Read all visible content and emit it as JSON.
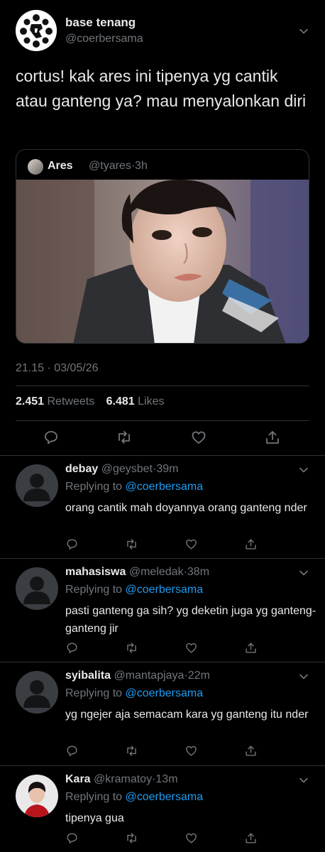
{
  "tweet": {
    "author_name": "base tenang",
    "author_handle": "@coerbersama",
    "text": "cortus! kak ares ini tipenya yg cantik atau ganteng ya? mau menyalonkan diri",
    "quote": {
      "name": "Ares",
      "handle": "@tyares",
      "time": "3h"
    },
    "timestamp": "21.15 · 03/05/26",
    "retweets_count": "2.451",
    "retweets_label": "Retweets",
    "likes_count": "6.481",
    "likes_label": "Likes"
  },
  "replies": [
    {
      "name": "debay",
      "handle": "@geysbet",
      "time": "39m",
      "replying_prefix": "Replying to",
      "replying_to": "@coerbersama",
      "text": "orang cantik mah doyannya orang ganteng nder"
    },
    {
      "name": "mahasiswa",
      "handle": "@meledak",
      "time": "38m",
      "replying_prefix": "Replying to",
      "replying_to": "@coerbersama",
      "text": "pasti ganteng ga sih? yg deketin juga yg ganteng-ganteng jir"
    },
    {
      "name": "syibalita",
      "handle": "@mantapjaya",
      "time": "22m",
      "replying_prefix": "Replying to",
      "replying_to": "@coerbersama",
      "text": "yg ngejer aja semacam kara yg ganteng itu nder"
    },
    {
      "name": "Kara",
      "handle": "@kramatoy",
      "time": "13m",
      "replying_prefix": "Replying to",
      "replying_to": "@coerbersama",
      "text": "tipenya gua"
    }
  ],
  "icons": {
    "reply": "reply-icon",
    "retweet": "retweet-icon",
    "like": "heart-icon",
    "share": "share-icon",
    "more": "chevron-down-icon"
  },
  "colors": {
    "background": "#000000",
    "text": "#e7e9ea",
    "secondary": "#71767b",
    "link": "#1d9bf0",
    "divider": "#2f3336"
  }
}
